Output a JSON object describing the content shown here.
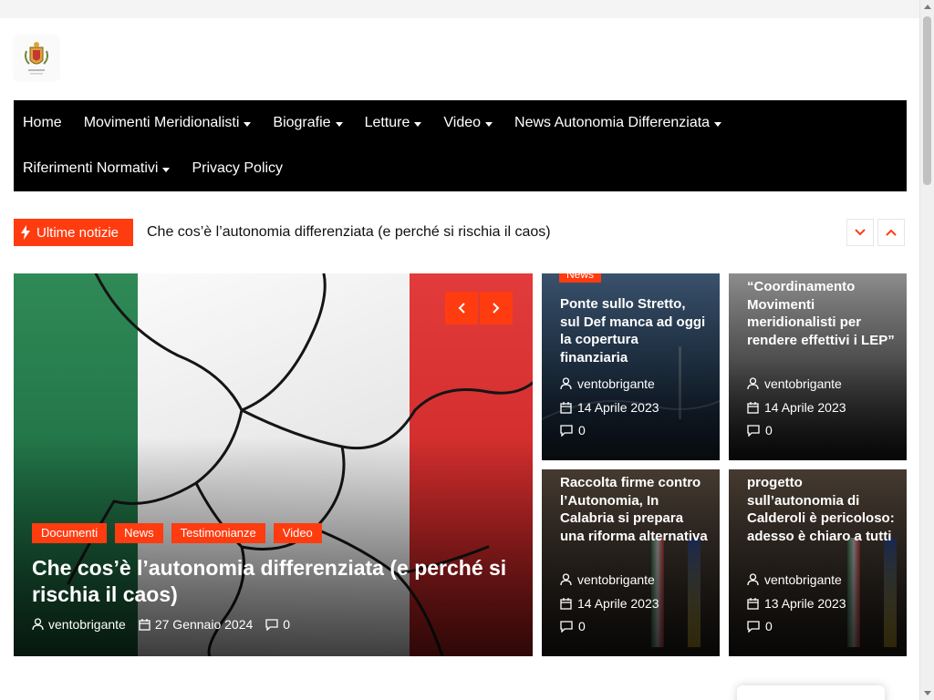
{
  "colors": {
    "accent": "#ff3c10",
    "nav_bg": "#000000"
  },
  "nav": {
    "row1": [
      {
        "label": "Home",
        "has_dropdown": false
      },
      {
        "label": "Movimenti Meridionalisti",
        "has_dropdown": true
      },
      {
        "label": "Biografie",
        "has_dropdown": true
      },
      {
        "label": "Letture",
        "has_dropdown": true
      },
      {
        "label": "Video",
        "has_dropdown": true
      },
      {
        "label": "News Autonomia Differenziata",
        "has_dropdown": true
      }
    ],
    "row2": [
      {
        "label": "Riferimenti Normativi",
        "has_dropdown": true
      },
      {
        "label": "Privacy Policy",
        "has_dropdown": false
      }
    ]
  },
  "ticker": {
    "label": "Ultime notizie",
    "icon": "bolt-icon",
    "headline": "Che cos’è l’autonomia differenziata (e perché si rischia il caos)"
  },
  "hero": {
    "tags": [
      "Documenti",
      "News",
      "Testimonianze",
      "Video"
    ],
    "title": "Che cos’è l’autonomia differenziata (e perché si rischia il caos)",
    "author": "ventobrigante",
    "date": "27 Gennaio 2024",
    "comments": "0"
  },
  "cards": [
    {
      "tag": "News",
      "title": "Ponte sullo Stretto, sul Def manca ad oggi la copertura finanziaria",
      "author": "ventobrigante",
      "date": "14 Aprile 2023",
      "comments": "0"
    },
    {
      "title": "“Coordinamento Movimenti meridionalisti per rendere effettivi i LEP”",
      "author": "ventobrigante",
      "date": "14 Aprile 2023",
      "comments": "0"
    },
    {
      "title": "Raccolta firme contro l’Autonomia, In Calabria si prepara una riforma alternativa",
      "author": "ventobrigante",
      "date": "14 Aprile 2023",
      "comments": "0"
    },
    {
      "title": "progetto sull’autonomia di Calderoli è pericoloso: adesso è chiaro a tutti",
      "author": "ventobrigante",
      "date": "13 Aprile 2023",
      "comments": "0"
    }
  ]
}
